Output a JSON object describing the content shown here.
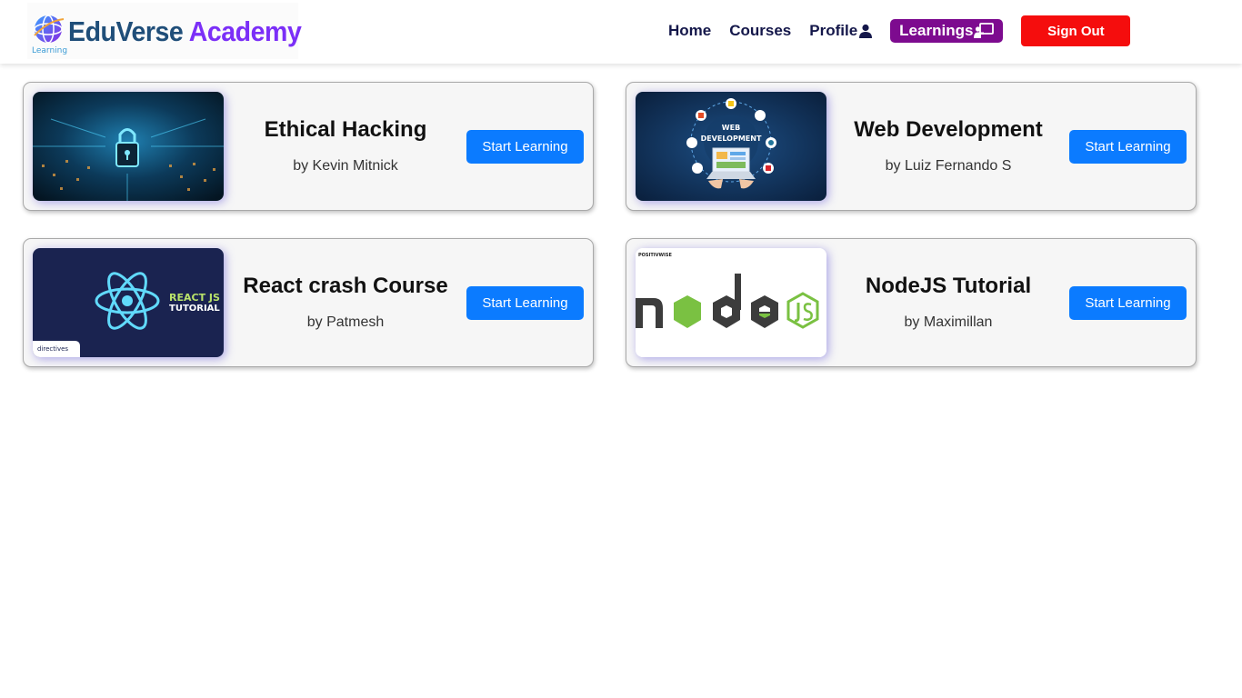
{
  "brand": {
    "name_part1": "EduVerse",
    "name_part2": "Academy",
    "tagline": "Learning"
  },
  "nav": {
    "home": "Home",
    "courses": "Courses",
    "profile": "Profile",
    "learnings": "Learnings",
    "sign_out": "Sign Out"
  },
  "courses": [
    {
      "title": "Ethical Hacking",
      "author": "by Kevin Mitnick",
      "button": "Start Learning",
      "thumb_icon": "padlock-circuit-image"
    },
    {
      "title": "Web Development",
      "author": "by Luiz Fernando S",
      "button": "Start Learning",
      "thumb_icon": "web-development-laptop-image",
      "thumb_text": [
        "WEB",
        "DEVELOPMENT"
      ]
    },
    {
      "title": "React crash Course",
      "author": "by Patmesh",
      "button": "Start Learning",
      "thumb_icon": "react-atom-image",
      "thumb_text": [
        "REACT JS",
        "TUTORIAL",
        "directives"
      ]
    },
    {
      "title": "NodeJS Tutorial",
      "author": "by Maximillan",
      "button": "Start Learning",
      "thumb_icon": "nodejs-logo-image",
      "thumb_text": [
        "POSITIVWISE"
      ]
    }
  ],
  "colors": {
    "nav_text": "#14174a",
    "learnings_bg": "#7d0b8f",
    "signout_bg": "#f50d0d",
    "button_bg": "#0b7bff",
    "card_bg": "#f6f6f6"
  }
}
